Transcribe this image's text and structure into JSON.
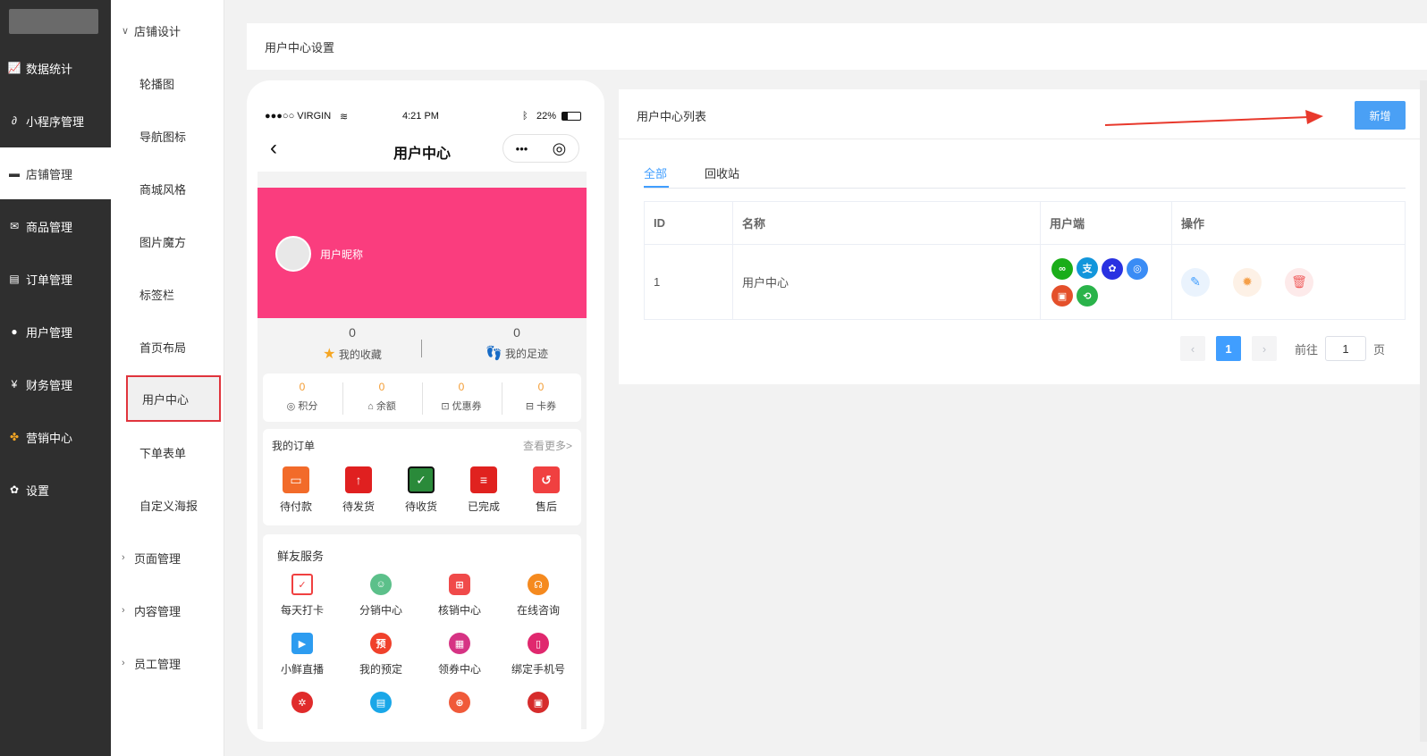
{
  "sidebar": {
    "items": [
      {
        "label": "数据统计",
        "icon": "line-chart-icon"
      },
      {
        "label": "小程序管理",
        "icon": "link-icon"
      },
      {
        "label": "店铺管理",
        "icon": "store-icon",
        "active": true
      },
      {
        "label": "商品管理",
        "icon": "mail-icon"
      },
      {
        "label": "订单管理",
        "icon": "document-icon"
      },
      {
        "label": "用户管理",
        "icon": "person-icon"
      },
      {
        "label": "财务管理",
        "icon": "yen-icon"
      },
      {
        "label": "营销中心",
        "icon": "colorful-icon"
      },
      {
        "label": "设置",
        "icon": "gear-icon"
      }
    ]
  },
  "submenu": {
    "group_store": "店铺设计",
    "items": [
      "轮播图",
      "导航图标",
      "商城风格",
      "图片魔方",
      "标签栏",
      "首页布局",
      "用户中心",
      "下单表单",
      "自定义海报"
    ],
    "group_page": "页面管理",
    "group_content": "内容管理",
    "group_staff": "员工管理"
  },
  "header": {
    "title": "用户中心设置"
  },
  "phone": {
    "carrier": "●●●○○ VIRGIN",
    "time": "4:21 PM",
    "battery": "22%",
    "title": "用户中心",
    "capsule_more": "•••",
    "capsule_target": "◎",
    "nickname": "用户昵称",
    "banner_color": "#fa3d7e",
    "favorites": {
      "count": "0",
      "label": "我的收藏"
    },
    "footprints": {
      "count": "0",
      "label": "我的足迹"
    },
    "stats": [
      {
        "value": "0",
        "label": "积分"
      },
      {
        "value": "0",
        "label": "余额"
      },
      {
        "value": "0",
        "label": "优惠券"
      },
      {
        "value": "0",
        "label": "卡券"
      }
    ],
    "orders": {
      "title": "我的订单",
      "more": "查看更多>",
      "items": [
        "待付款",
        "待发货",
        "待收货",
        "已完成",
        "售后"
      ]
    },
    "services": {
      "title": "鲜友服务",
      "items": [
        "每天打卡",
        "分销中心",
        "核销中心",
        "在线咨询",
        "小鲜直播",
        "我的预定",
        "领券中心",
        "绑定手机号"
      ],
      "reserve_glyph": "预"
    }
  },
  "panel": {
    "title": "用户中心列表",
    "new_button": "新增",
    "tabs": [
      "全部",
      "回收站"
    ],
    "columns": [
      "ID",
      "名称",
      "用户端",
      "操作"
    ],
    "rows": [
      {
        "id": "1",
        "name": "用户中心",
        "platforms": [
          "wechat-mini-icon",
          "alipay-icon",
          "baidu-icon",
          "qq-icon",
          "toutiao-icon",
          "h5-icon"
        ]
      }
    ],
    "pagination": {
      "current": "1",
      "goto_label": "前往",
      "goto_value": "1",
      "page_suffix": "页"
    }
  },
  "colors": {
    "accent": "#409eff",
    "new_button": "#4aa0f5",
    "highlight_border": "#e0343d",
    "arrow": "#e8392c"
  }
}
